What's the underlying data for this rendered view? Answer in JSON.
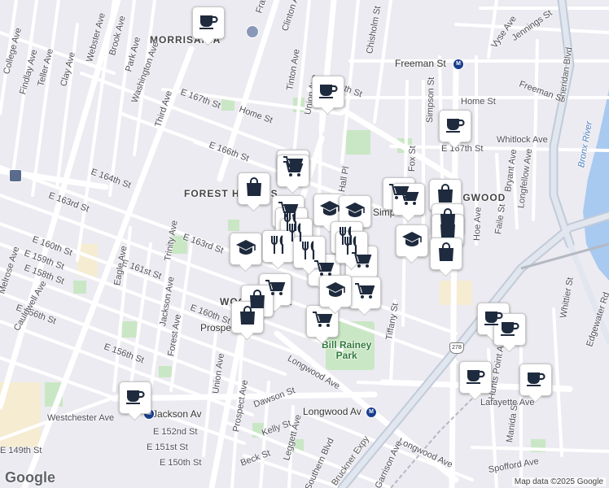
{
  "attribution": "Map data ©2025 Google",
  "logo": "Google",
  "neighborhoods": [
    "MORRISANIA",
    "FOREST HOUSES",
    "WOODSTOCK",
    "LONGWOOD"
  ],
  "park": "Bill Rainey\nPark",
  "water": "Bronx River",
  "highways": [
    "Bruckner Expy",
    "Sheridan Blvd"
  ],
  "highway_shield": "278",
  "stations": [
    "Freeman St",
    "Simpson St",
    "Jackson Av",
    "Longwood Av",
    "Prospect Av"
  ],
  "streets": [
    "College Ave",
    "Findlay Ave",
    "Teller Ave",
    "Clay Ave",
    "Webster Ave",
    "Brook Ave",
    "Park Ave",
    "Washington Ave",
    "E 167th St",
    "Third Ave",
    "Tinton Ave",
    "Union Ave",
    "E 169th St",
    "Home St",
    "E 166th St",
    "E 164th St",
    "E 163rd St",
    "E 161st St",
    "E 160th St",
    "E 159th St",
    "E 158th St",
    "E 156th St",
    "Melrose Ave",
    "Cauldwell Ave",
    "Eagle Ave",
    "Trinity Ave",
    "Jackson Ave",
    "Forest Ave",
    "E 160th St",
    "E 156th St",
    "Union Ave",
    "Prospect Ave",
    "Dawson St",
    "Kelly St",
    "Beck St",
    "Leggett Ave",
    "Southern Blvd",
    "Longwood Ave",
    "Tiffany St",
    "Fox St",
    "Simpson St",
    "Chisholm St",
    "Hall Pl",
    "Freeman St",
    "Home St",
    "E 167th St",
    "Whitlock Ave",
    "Bryant Ave",
    "Longfellow Ave",
    "Faile St",
    "Hoe Ave",
    "Vyse Ave",
    "Jennings St",
    "Hunts Point Ave",
    "Manida St",
    "Lafayette Ave",
    "Spofford Ave",
    "Edgewater Rd",
    "Whittier St",
    "Westchester Ave",
    "E 152nd St",
    "E 151st St",
    "E 150th St",
    "E 149th St",
    "Clinton Ave",
    "Franklin Ave",
    "Longwood Ave",
    "Garrison Ave"
  ],
  "markers": [
    {
      "type": "coffee",
      "label": "coffee-shop"
    },
    {
      "type": "coffee",
      "label": "coffee-shop"
    },
    {
      "type": "coffee",
      "label": "coffee-shop"
    },
    {
      "type": "coffee",
      "label": "coffee-shop"
    },
    {
      "type": "coffee",
      "label": "coffee-shop"
    },
    {
      "type": "coffee",
      "label": "coffee-shop"
    },
    {
      "type": "coffee",
      "label": "coffee-shop"
    },
    {
      "type": "shopping-cart",
      "label": "grocery"
    },
    {
      "type": "shopping-bag",
      "label": "store"
    },
    {
      "type": "education",
      "label": "school"
    },
    {
      "type": "restaurant",
      "label": "restaurant"
    }
  ]
}
